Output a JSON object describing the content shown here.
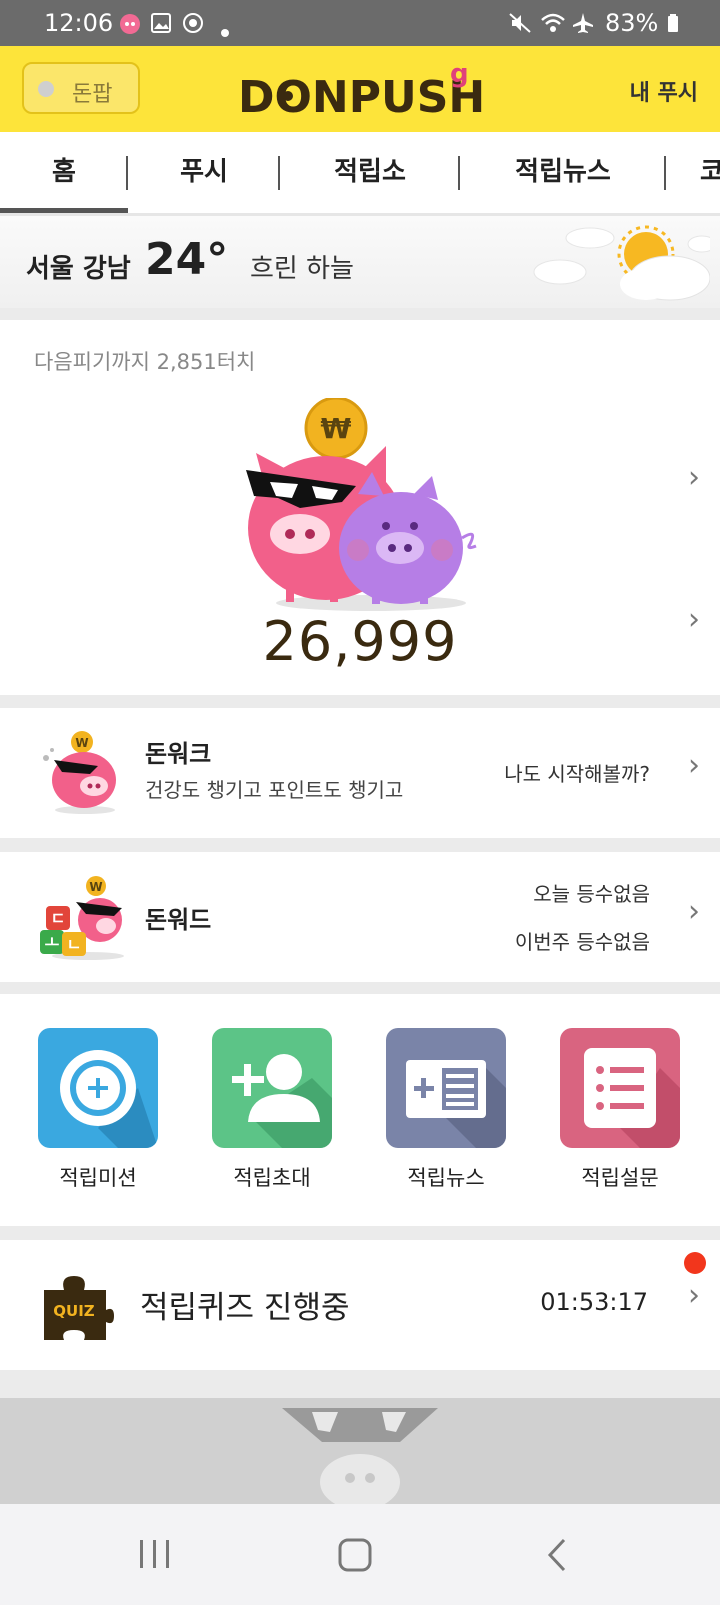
{
  "status_bar": {
    "time": "12:06",
    "battery": "83%"
  },
  "header": {
    "donpop_label": "돈팝",
    "logo_text": "DONPUSH",
    "logo_superscript": "g",
    "my_push": "내 푸시"
  },
  "tabs": [
    {
      "label": "홈"
    },
    {
      "label": "푸시"
    },
    {
      "label": "적립소"
    },
    {
      "label": "적립뉴스"
    },
    {
      "label": "코"
    }
  ],
  "weather": {
    "location": "서울 강남",
    "temperature": "24°",
    "condition": "흐린 하늘"
  },
  "points": {
    "next_level_text": "다음피기까지 2,851터치",
    "coin_symbol": "₩",
    "amount": "26,999"
  },
  "donwalk": {
    "title": "돈워크",
    "subtitle": "건강도 챙기고 포인트도 챙기고",
    "right_text": "나도 시작해볼까?",
    "coin_symbol": "W"
  },
  "donword": {
    "title": "돈워드",
    "right_line1": "오늘 등수없음",
    "right_line2": "이번주 등수없음",
    "coin_symbol": "W",
    "tile_letters": [
      "ㄷ",
      "ㅗ",
      "ㄴ"
    ]
  },
  "grid": [
    {
      "label": "적립미션",
      "icon": "mission-plus-icon",
      "color": "#3aa8e0"
    },
    {
      "label": "적립초대",
      "icon": "invite-user-icon",
      "color": "#5cc487"
    },
    {
      "label": "적립뉴스",
      "icon": "news-icon",
      "color": "#7a84a8"
    },
    {
      "label": "적립설문",
      "icon": "survey-list-icon",
      "color": "#d96480"
    }
  ],
  "quiz": {
    "icon_text": "QUIZ",
    "title": "적립퀴즈 진행중",
    "timer": "01:53:17"
  },
  "colors": {
    "accent_yellow": "#fde43a",
    "pig_pink": "#f2608a",
    "pig_purple": "#b67ee6",
    "coin_gold": "#f2b320",
    "alert_red": "#f2361c"
  }
}
